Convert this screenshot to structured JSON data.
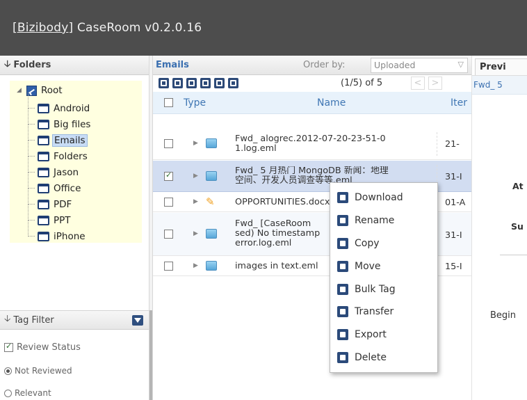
{
  "app": {
    "brand": "[Bizibody]",
    "title_rest": " CaseRoom v0.2.0.16"
  },
  "folders_panel": {
    "title": "Folders",
    "root": "Root",
    "items": [
      "Android",
      "Big files",
      "Emails",
      "Folders",
      "Jason",
      "Office",
      "PDF",
      "PPT",
      "iPhone"
    ],
    "selected": "Emails"
  },
  "tag_filter": {
    "title": "Tag Filter",
    "review_status_label": "Review Status",
    "options": [
      "Not Reviewed",
      "Relevant"
    ]
  },
  "emails_panel": {
    "title": "Emails",
    "order_label": "Order by:",
    "order_value": "Uploaded",
    "pager_text": "(1/5) of 5",
    "prev": "<",
    "next": ">",
    "columns": {
      "type": "Type",
      "name": "Name",
      "item": "Iter"
    },
    "rows": [
      {
        "name_line1": "Fwd_ alogrec.2012-07-20-23-51-0",
        "name_line2": "1.log.eml",
        "item": "21-",
        "checked": false
      },
      {
        "name_line1": "Fwd_ 5 月热门 MongoDB 新闻：地理",
        "name_line2": "空间、开发人员调查等等.eml",
        "item": "31-I",
        "checked": true
      },
      {
        "name_line1": "OPPORTUNITIES.docx",
        "name_line2": "",
        "item": "01-A",
        "checked": false
      },
      {
        "name_line1": "Fwd_ [CaseRoom",
        "name_line2": "sed) No timestamp",
        "name_line3": "error.log.eml",
        "item": "31-I",
        "checked": false
      },
      {
        "name_line1": "images in text.eml",
        "name_line2": "",
        "item": "15-I",
        "checked": false
      }
    ]
  },
  "context_menu": {
    "items": [
      "Download",
      "Rename",
      "Copy",
      "Move",
      "Bulk Tag",
      "Transfer",
      "Export",
      "Delete"
    ]
  },
  "preview_panel": {
    "tab": "Previ",
    "subtitle": "Fwd_ 5 ",
    "label_at": "At",
    "label_su": "Su",
    "text_begin": "Begin"
  },
  "colors": {
    "header_bg": "#4d4d4d",
    "accent": "#3a6fb0",
    "tree_bg": "#ffffe0"
  }
}
